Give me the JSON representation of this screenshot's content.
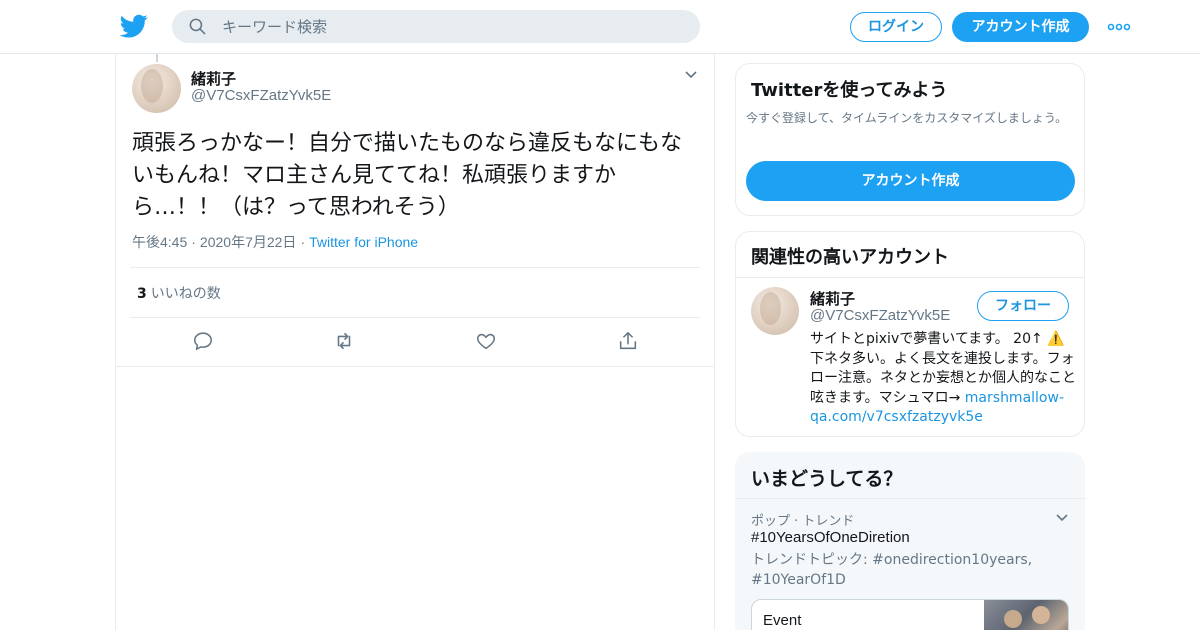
{
  "header": {
    "search_placeholder": "キーワード検索",
    "login_label": "ログイン",
    "signup_label": "アカウント作成"
  },
  "tweet": {
    "name": "緒莉子",
    "handle": "@V7CsxFZatzYvk5E",
    "text": "頑張ろっかなー！自分で描いたものなら違反もなにもないもんね！マロ主さん見ててね！私頑張りますから…！！（は？って思われそう）",
    "time": "午後4:45",
    "date": "2020年7月22日",
    "source": "Twitter for iPhone",
    "likes_count": "3",
    "likes_label": "いいねの数"
  },
  "sidebar": {
    "signup_card": {
      "title": "Twitterを使ってみよう",
      "description": "今すぐ登録して、タイムラインをカスタマイズしましょう。",
      "button_label": "アカウント作成"
    },
    "related_card": {
      "title": "関連性の高いアカウント",
      "account": {
        "name": "緒莉子",
        "handle": "@V7CsxFZatzYvk5E",
        "follow_label": "フォロー",
        "bio": "サイトとpixivで夢書いてます。 20↑ ⚠️下ネタ多い。よく長文を連投します。フォロー注意。ネタとか妄想とか個人的なこと呟きます。マシュマロ→",
        "bio_link": "marshmallow-qa.com/v7csxfzatzyvk5e"
      }
    },
    "trends_card": {
      "title": "いまどうしてる？",
      "trend": {
        "category": "ポップ · トレンド",
        "name": "#10YearsOfOneDiretion",
        "topic": "トレンドトピック: #onedirection10years, #10YearOf1D"
      },
      "event_label": "Event"
    }
  },
  "colors": {
    "accent": "#1da1f2",
    "link": "#1b95e0",
    "secondary_text": "#657786",
    "border": "#e6ecf0"
  },
  "icons": {
    "logo": "twitter-bird-icon",
    "search": "search-icon",
    "more": "more-dots-icon",
    "caret": "chevron-down-icon",
    "reply": "reply-icon",
    "retweet": "retweet-icon",
    "like": "heart-icon",
    "share": "share-icon"
  }
}
